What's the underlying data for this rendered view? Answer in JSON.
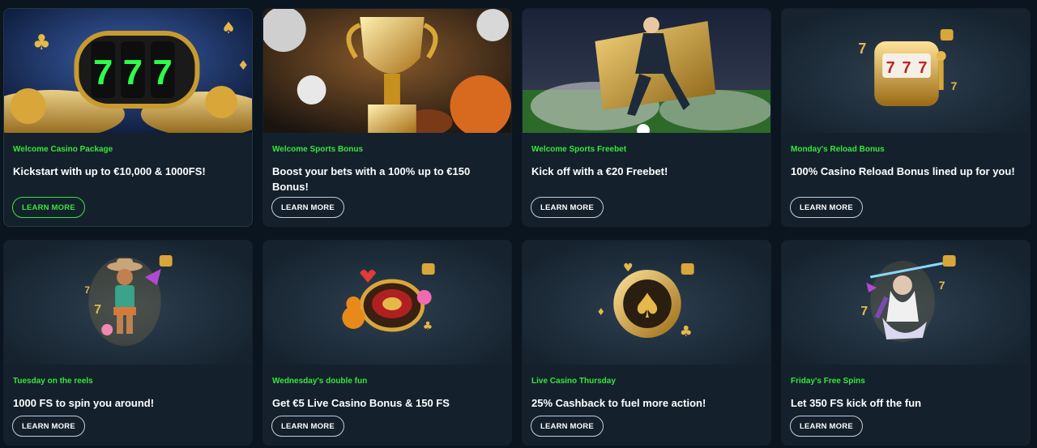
{
  "colors": {
    "page_bg": "#0b1520",
    "card_bg": "#14212d",
    "tag_green": "#39e639",
    "gold": "#e5b84a"
  },
  "cards": [
    {
      "tag": "Welcome Casino Package",
      "title": "Kickstart with up to €10,000 & 1000FS!",
      "button": "LEARN MORE",
      "art": "slot-reels-777-coins",
      "highlight": true
    },
    {
      "tag": "Welcome Sports Bonus",
      "title": "Boost your bets with a 100% up to €150 Bonus!",
      "button": "LEARN MORE",
      "art": "gold-trophy-sports-balls"
    },
    {
      "tag": "Welcome Sports Freebet",
      "title": "Kick off with a €20 Freebet!",
      "button": "LEARN MORE",
      "art": "football-player-golden-ticket"
    },
    {
      "tag": "Monday's Reload Bonus",
      "title": "100% Casino Reload Bonus lined up for you!",
      "button": "LEARN MORE",
      "art": "golden-slot-machine"
    },
    {
      "tag": "Tuesday on the reels",
      "title": "1000 FS to spin you around!",
      "button": "LEARN MORE",
      "art": "cowboy-character"
    },
    {
      "tag": "Wednesday's double fun",
      "title": "Get €5 Live Casino Bonus & 150 FS",
      "button": "LEARN MORE",
      "art": "roulette-wheel-teddy-bear"
    },
    {
      "tag": "Live Casino Thursday",
      "title": "25% Cashback to fuel more action!",
      "button": "LEARN MORE",
      "art": "gold-poker-chip-spade"
    },
    {
      "tag": "Friday's Free Spins",
      "title": "Let 350 FS kick off the fun",
      "button": "LEARN MORE",
      "art": "zeus-character-lightning"
    }
  ]
}
